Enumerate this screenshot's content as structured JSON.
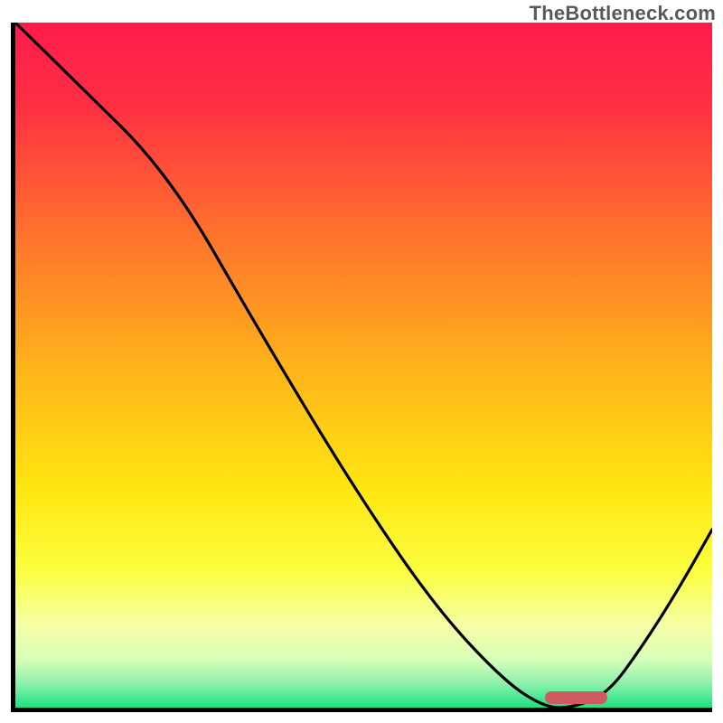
{
  "watermark": "TheBottleneck.com",
  "chart_data": {
    "type": "line",
    "title": "",
    "xlabel": "",
    "ylabel": "",
    "xlim": [
      0,
      100
    ],
    "ylim": [
      0,
      100
    ],
    "x": [
      0,
      8,
      22,
      35,
      48,
      60,
      70,
      76,
      80,
      85,
      90,
      95,
      100
    ],
    "bottleneck_pct": [
      100,
      92,
      78,
      55,
      33,
      15,
      4,
      0,
      0,
      2,
      9,
      17,
      26
    ],
    "optimal_range_x": [
      76,
      85
    ],
    "gradient_stops": [
      {
        "offset": 0.0,
        "color": "#ff1b4b"
      },
      {
        "offset": 0.12,
        "color": "#ff2f43"
      },
      {
        "offset": 0.3,
        "color": "#ff6f2e"
      },
      {
        "offset": 0.5,
        "color": "#ffb21a"
      },
      {
        "offset": 0.68,
        "color": "#ffe610"
      },
      {
        "offset": 0.8,
        "color": "#fbff3f"
      },
      {
        "offset": 0.88,
        "color": "#f6ffa6"
      },
      {
        "offset": 0.93,
        "color": "#d6ffb8"
      },
      {
        "offset": 0.965,
        "color": "#8cf0ac"
      },
      {
        "offset": 1.0,
        "color": "#19e37f"
      }
    ],
    "marker_color": "#cf5b60"
  }
}
